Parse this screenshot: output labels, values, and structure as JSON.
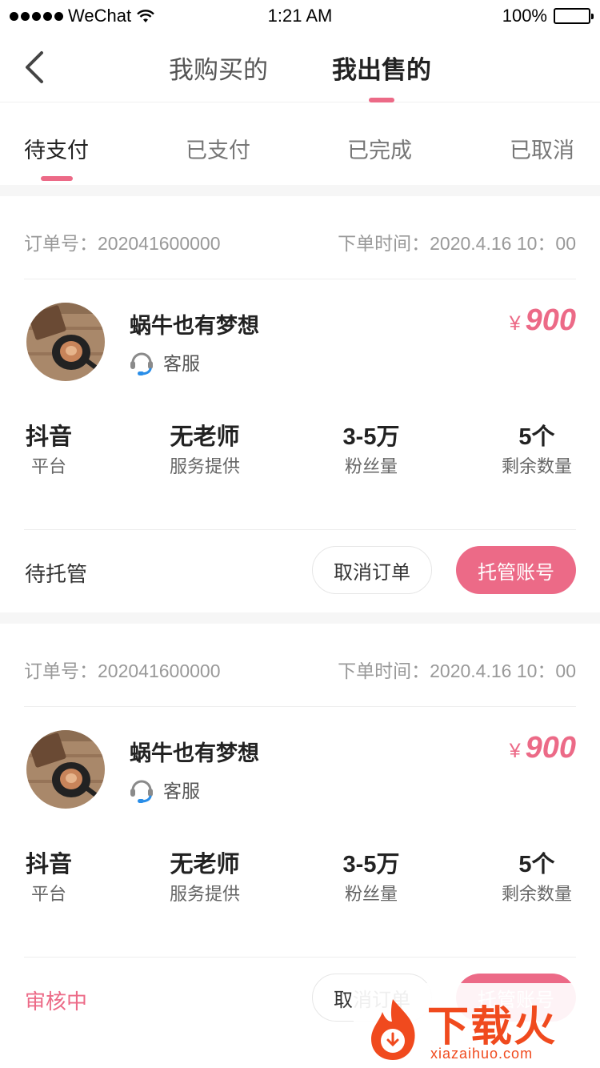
{
  "status_bar": {
    "carrier": "WeChat",
    "time": "1:21 AM",
    "battery": "100%"
  },
  "nav": {
    "tabs": [
      {
        "label": "我购买的",
        "active": false
      },
      {
        "label": "我出售的",
        "active": true
      }
    ]
  },
  "subtabs": [
    {
      "label": "待支付",
      "active": true
    },
    {
      "label": "已支付",
      "active": false
    },
    {
      "label": "已完成",
      "active": false
    },
    {
      "label": "已取消",
      "active": false
    }
  ],
  "orders": [
    {
      "order_no": "订单号：202041600000",
      "order_time": "下单时间：2020.4.16 10：00",
      "shop_name": "蜗牛也有梦想",
      "service_label": "客服",
      "currency": "¥",
      "price": "900",
      "stats": [
        {
          "value": "抖音",
          "label": "平台"
        },
        {
          "value": "无老师",
          "label": "服务提供"
        },
        {
          "value": "3-5万",
          "label": "粉丝量"
        },
        {
          "value": "5个",
          "label": "剩余数量"
        }
      ],
      "status": "待托管",
      "cancel_label": "取消订单",
      "primary_label": "托管账号"
    },
    {
      "order_no": "订单号：202041600000",
      "order_time": "下单时间：2020.4.16 10：00",
      "shop_name": "蜗牛也有梦想",
      "service_label": "客服",
      "currency": "¥",
      "price": "900",
      "stats": [
        {
          "value": "抖音",
          "label": "平台"
        },
        {
          "value": "无老师",
          "label": "服务提供"
        },
        {
          "value": "3-5万",
          "label": "粉丝量"
        },
        {
          "value": "5个",
          "label": "剩余数量"
        }
      ],
      "status": "审核中",
      "cancel_label": "取消订单",
      "primary_label": "托管账号"
    }
  ],
  "watermark": {
    "cn": "下载火",
    "en": "xiazaihuo.com"
  },
  "colors": {
    "accent": "#ec6a87",
    "service_icon": "#2a8ee8",
    "watermark": "#f04a1e"
  }
}
